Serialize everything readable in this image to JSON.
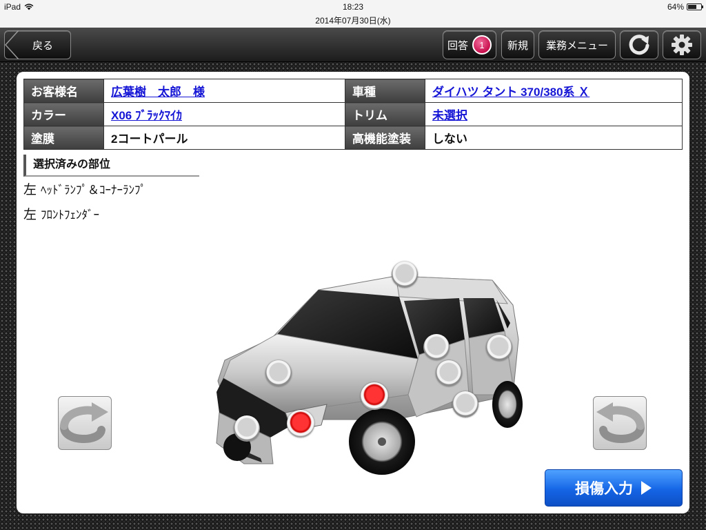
{
  "status": {
    "device": "iPad",
    "time": "18:23",
    "date": "2014年07月30日(水)",
    "battery": "64%",
    "battery_level": 0.64
  },
  "toolbar": {
    "back_label": "戻る",
    "answer_label": "回答",
    "answer_count": "1",
    "new_label": "新規",
    "menu_label": "業務メニュー",
    "refresh_icon": "refresh-icon",
    "settings_icon": "gear-icon",
    "badge_color": "#d6145a"
  },
  "info": {
    "rows": [
      {
        "label1": "お客様名",
        "value1": "広葉樹　太郎　様",
        "label2": "車種",
        "value2": "ダイハツ タント 370/380系 Ｘ"
      },
      {
        "label1": "カラー",
        "value1": "X06 ﾌﾞﾗｯｸﾏｲｶ",
        "label2": "トリム",
        "value2": "未選択"
      },
      {
        "label1": "塗膜",
        "value1": "2コートパール",
        "label2": "高機能塗装",
        "value2": "しない"
      }
    ]
  },
  "selected": {
    "heading": "選択済みの部位",
    "items": [
      {
        "side": "左",
        "part": "ﾍｯﾄﾞﾗﾝﾌﾟ＆ｺｰﾅｰﾗﾝﾌﾟ"
      },
      {
        "side": "左",
        "part": "ﾌﾛﾝﾄﾌｪﾝﾀﾞｰ"
      }
    ]
  },
  "markers": {
    "selected_color": "#e00000",
    "unselected_color": "#c8c8c8"
  },
  "actions": {
    "damage_input_label": "損傷入力",
    "damage_button_color": "#1a6cf0"
  }
}
